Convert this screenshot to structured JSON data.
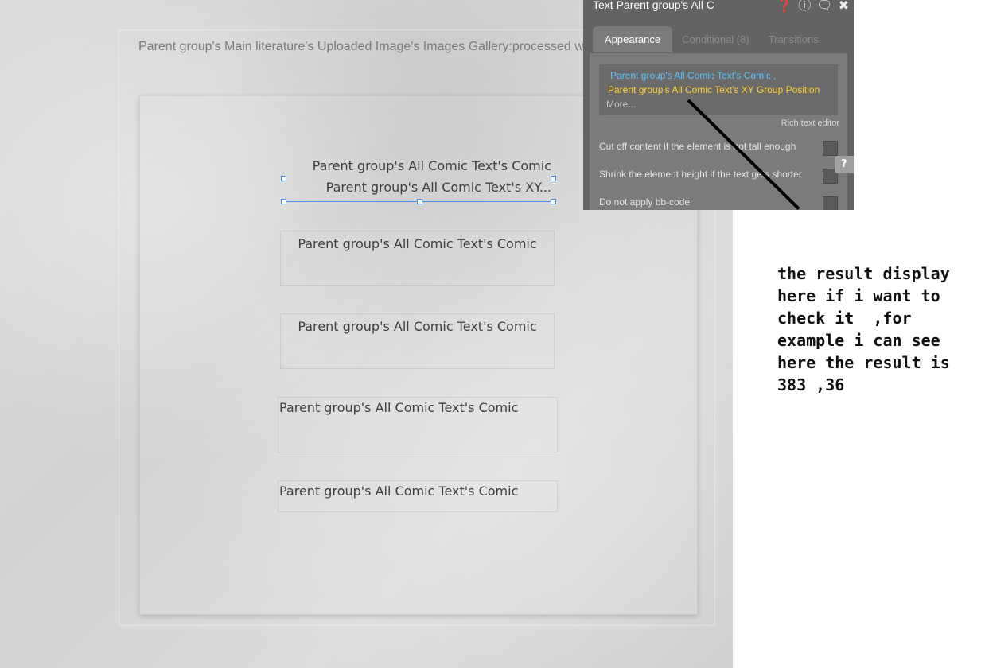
{
  "canvas": {
    "gallery_text": "Parent group's Main literature's Uploaded Image's Images Gallery:processed w",
    "selected_text": {
      "line1": "Parent group's All Comic Text's Comic",
      "line2": "Parent group's All Comic Text's XY..."
    },
    "comic_rows": [
      "Parent group's All Comic Text's Comic",
      "Parent group's All Comic Text's Comic",
      "Parent group's All Comic Text's Comic",
      "Parent group's All Comic Text's Comic"
    ]
  },
  "property_panel": {
    "title": "Text Parent group's All C",
    "icons": [
      "help-icon",
      "info-icon",
      "comment-icon",
      "close-icon"
    ],
    "tabs": [
      {
        "label": "Appearance",
        "active": true
      },
      {
        "label": "Conditional (8)",
        "active": false
      },
      {
        "label": "Transitions",
        "active": false
      }
    ],
    "expression": {
      "part1": "Parent group's All Comic Text's Comic ,",
      "part2": "Parent group's All Comic Text's XY Group Position",
      "more": "More..."
    },
    "rich_text_editor": "Rich text editor",
    "options": [
      {
        "label": "Cut off content if the element is not tall enough",
        "checked": false
      },
      {
        "label": "Shrink the element height if the text gets shorter",
        "checked": false
      },
      {
        "label": "Do not apply bb-code",
        "checked": false
      }
    ],
    "help_badge": "?",
    "colors": {
      "panel_bg": "#636363",
      "body_bg": "#7b7b7b",
      "expr_blue": "#5ec4ff",
      "expr_yellow": "#ffcc33",
      "selection": "#4a90e2"
    }
  },
  "annotation": {
    "lines": [
      "the result display",
      "here if i want to",
      "check it  ,for",
      "example i can see",
      "here the result is",
      "383 ,36"
    ]
  }
}
